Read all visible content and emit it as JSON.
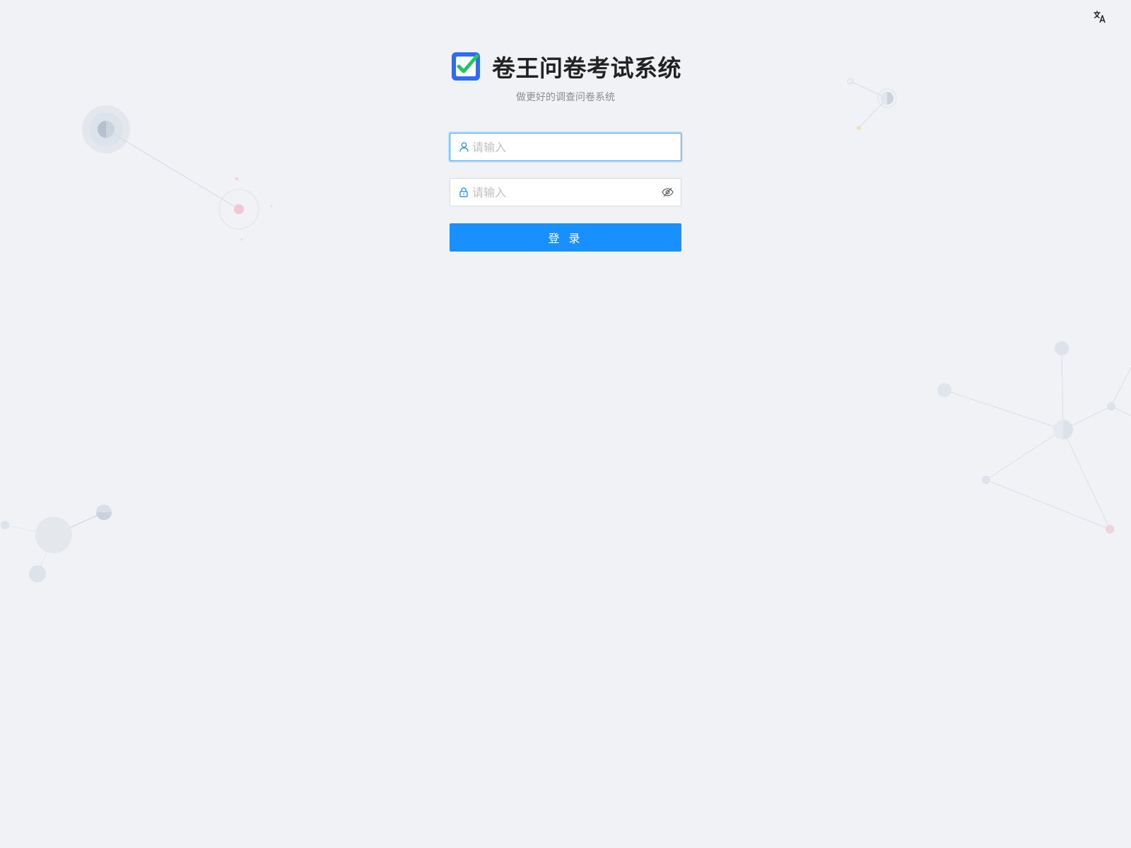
{
  "header": {
    "language_icon": "translate-icon"
  },
  "brand": {
    "logo_icon": "checkbox-logo",
    "title": "卷王问卷考试系统",
    "subtitle": "做更好的调查问卷系统",
    "logo_colors": {
      "box": "#2b6df5",
      "check": "#22c55e"
    }
  },
  "login_form": {
    "username": {
      "placeholder": "请输入",
      "value": "",
      "icon": "user-icon"
    },
    "password": {
      "placeholder": "请输入",
      "value": "",
      "icon": "lock-icon",
      "toggle_icon": "eye-invisible-icon"
    },
    "submit_label": "登 录"
  },
  "theme": {
    "background": "#f0f2f5",
    "primary": "#1890ff"
  }
}
